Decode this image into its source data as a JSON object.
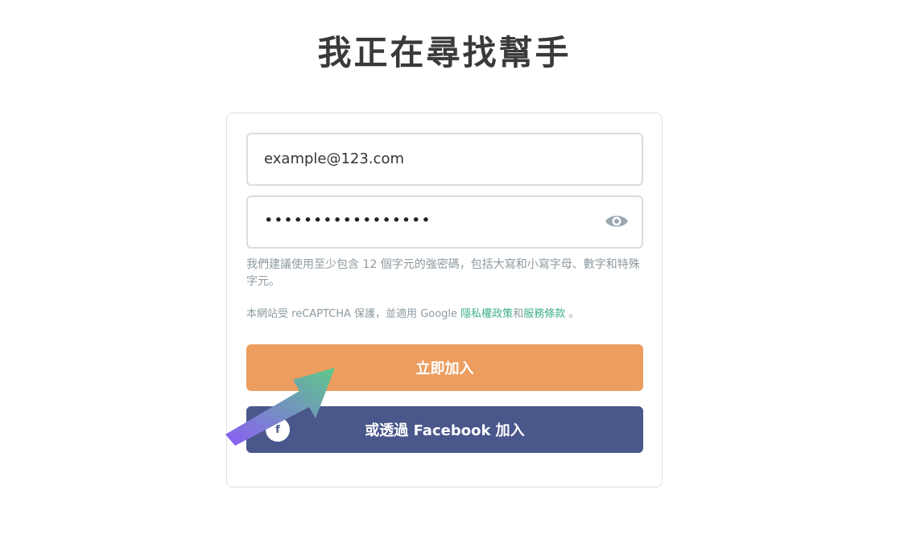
{
  "page": {
    "title": "我正在尋找幫手"
  },
  "form": {
    "email_value": "example@123.com",
    "password_mask": "•••••••••••••••••",
    "password_hint": "我們建議使用至少包含 12 個字元的強密碼，包括大寫和小寫字母、數字和特殊字元。",
    "recaptcha_prefix": "本網站受 reCAPTCHA 保護，並適用 Google ",
    "privacy_link": "隱私權政策",
    "recaptcha_and": "和",
    "terms_link": "服務條款",
    "recaptcha_suffix": " 。"
  },
  "buttons": {
    "join_label": "立即加入",
    "facebook_label": "或透過 Facebook 加入",
    "facebook_icon_glyph": "f"
  },
  "colors": {
    "join_button": "#ec9d5f",
    "facebook_button": "#4a578b",
    "link": "#3fae8c",
    "arrow_start": "#8b5cf6",
    "arrow_end": "#5cc98a"
  },
  "icons": {
    "eye": "eye-icon",
    "facebook": "facebook-icon",
    "annotation": "arrow-icon"
  }
}
